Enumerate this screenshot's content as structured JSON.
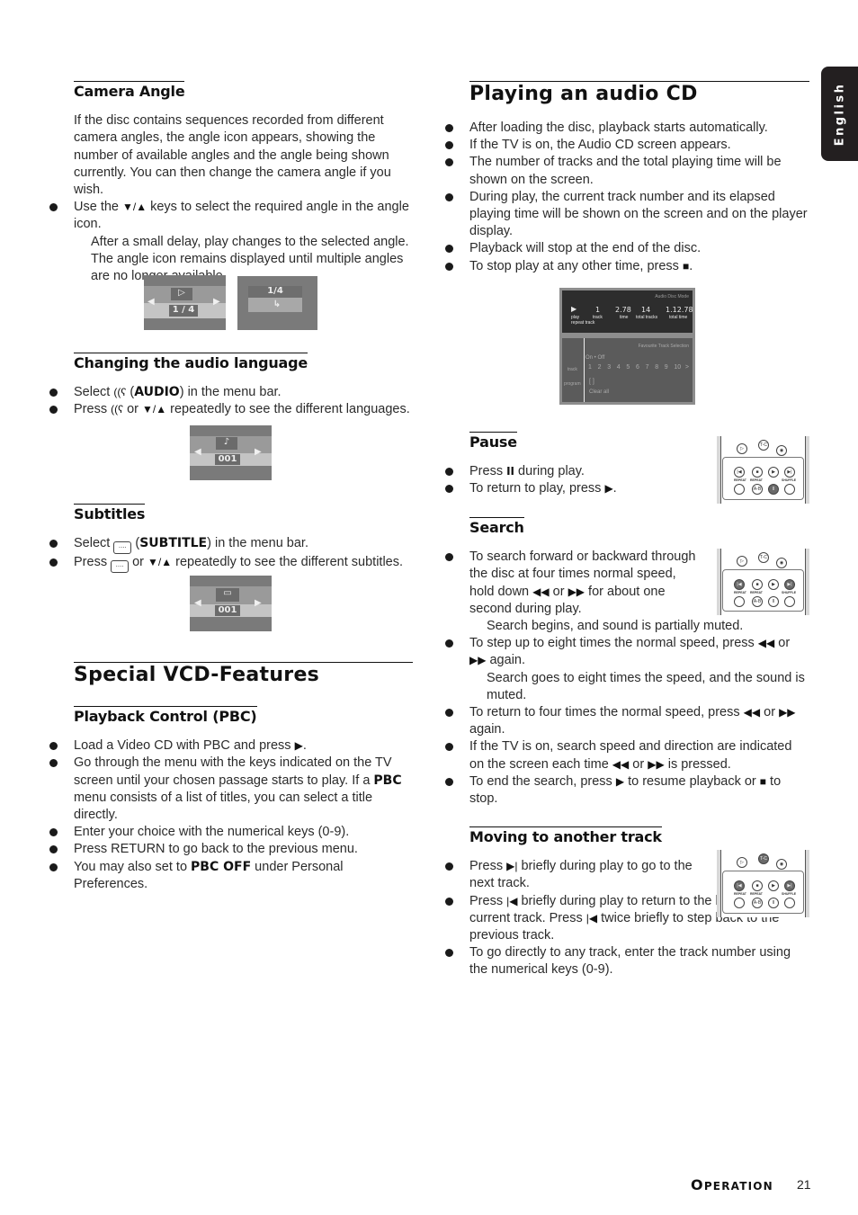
{
  "language_tab": "English",
  "left": {
    "camera_angle": {
      "heading": "Camera Angle",
      "intro": "If the disc contains sequences recorded from different camera angles, the angle icon appears, showing the number of available angles and the angle being shown currently. You can then change the camera angle if you wish.",
      "bullet_1_pre": "Use the ",
      "bullet_1_keys": "▼/▲",
      "bullet_1_post": " keys to select the required angle in the angle icon.",
      "note": "After a small delay, play changes to the selected angle. The angle icon remains displayed until multiple angles are no longer available.",
      "osd_1_value": "1 / 4",
      "osd_2_value": "1/4"
    },
    "audio_language": {
      "heading": "Changing the audio language",
      "b1_pre": "Select ",
      "b1_icon": "((ʕ",
      "b1_bold": "AUDIO",
      "b1_post": ") in the menu bar.",
      "b2_pre": "Press ",
      "b2_mid": " or ",
      "b2_keys": "▼/▲",
      "b2_post": " repeatedly to see the different languages.",
      "osd_value": "001"
    },
    "subtitles": {
      "heading": "Subtitles",
      "b1_pre": "Select ",
      "b1_bold": "SUBTITLE",
      "b1_post": ") in the menu bar.",
      "b2_pre": "Press ",
      "b2_mid": " or ",
      "b2_keys": "▼/▲",
      "b2_post": " repeatedly to see the different subtitles.",
      "icon_glyph": "....",
      "osd_value": "001"
    },
    "vcd": {
      "title": "Special VCD-Features",
      "pbc_heading": "Playback Control (PBC)",
      "b1": "Load a Video CD with PBC and press ",
      "b1_key": "▶",
      "b2_pre": "Go through the menu with the keys indicated on the TV screen until your chosen passage starts to play. If a ",
      "b2_bold": "PBC",
      "b2_post": " menu consists of a list of titles, you can select a title directly.",
      "b3": "Enter your choice with the numerical keys (0-9).",
      "b4": "Press RETURN to go back to the previous menu.",
      "b5_pre": "You may also set to ",
      "b5_bold": "PBC OFF",
      "b5_post": " under Personal Preferences."
    }
  },
  "right": {
    "audio_cd": {
      "title": "Playing an audio CD",
      "bullets": [
        "After loading the disc, playback starts automatically.",
        "If the TV is on, the Audio CD screen appears.",
        "The number of tracks and the total playing time will be shown on the screen.",
        "During play, the current track number and its elapsed playing time will be shown on the screen and on the player display.",
        "Playback will stop at the end of the disc."
      ],
      "stop_pre": "To stop play at any other time, press ",
      "stop_key": "■",
      "screen": {
        "mode": "Audio Disc Mode",
        "play_label": "play",
        "play_sub": "repeat track",
        "track_val": "1",
        "track_label": "track",
        "time_val": "2.78",
        "time_label": "time",
        "total_tracks_val": "14",
        "total_tracks_label": "total tracks",
        "total_time_val": "1.12.78",
        "total_time_label": "total time",
        "fav_title": "Favourite Track Selection",
        "onoff": "On  • Off",
        "track_row_label": "track",
        "tracks": [
          "1",
          "2",
          "3",
          "4",
          "5",
          "6",
          "7",
          "8",
          "9",
          "10"
        ],
        "more": ">",
        "program_label": "program",
        "program_val": "[ ]",
        "clear": "Clear all"
      }
    },
    "pause": {
      "heading": "Pause",
      "b1_pre": "Press ",
      "b1_key": "II",
      "b1_post": " during play.",
      "b2_pre": "To return to play, press ",
      "b2_key": "▶"
    },
    "search": {
      "heading": "Search",
      "b1_pre": "To search forward or backward through the disc at four times normal speed, hold down ",
      "b1_mid": " or ",
      "b1_post": " for about one second during play.",
      "note1": "Search begins, and sound is partially muted.",
      "b2_pre": "To step up to eight times the normal speed, press ",
      "b2_mid": " or ",
      "b2_post": " again.",
      "note2": "Search goes to eight times the speed, and the sound is muted.",
      "b3_pre": "To return to four times the normal speed, press ",
      "b3_mid": " or ",
      "b3_post": " again.",
      "b4_pre": "If the TV is on, search speed and direction are indicated on the screen each time ",
      "b4_mid": " or ",
      "b4_post": " is pressed.",
      "b5_pre": "To end the search, press ",
      "b5_key1": "▶",
      "b5_mid": " to resume playback or ",
      "b5_key2": "■",
      "b5_post": " to stop.",
      "rew": "◀◀",
      "ffw": "▶▶"
    },
    "track": {
      "heading": "Moving to another track",
      "b1_pre": "Press ",
      "b1_key": "▶|",
      "b1_post": " briefly during play to go to the next track.",
      "b2_pre": "Press ",
      "b2_key": "|◀",
      "b2_mid": " briefly during play to return to the beginning of the current track. Press ",
      "b2_post": " twice briefly to step back to the previous track.",
      "b3": "To go directly to any track, enter the track number using the numerical keys (0-9)."
    },
    "remote": {
      "repeat": "REPEAT",
      "repeat_ab": "REPEAT",
      "shuffle": "SHUFFLE",
      "t_c": "T-C",
      "ab": "A-B"
    }
  },
  "footer": {
    "section_cap": "O",
    "section_rest": "PERATION",
    "page": "21"
  }
}
